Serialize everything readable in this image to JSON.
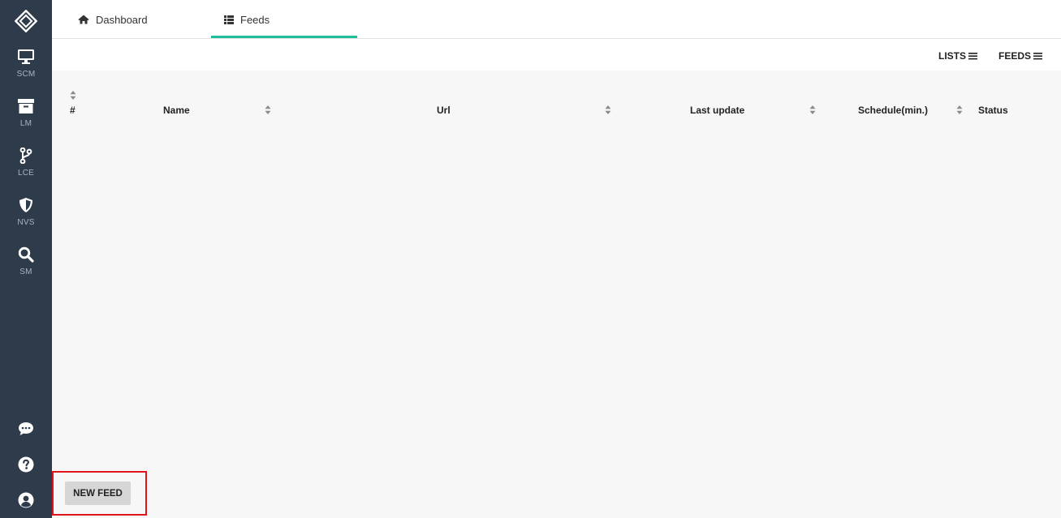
{
  "sidebar": {
    "items": [
      {
        "label": "SCM",
        "icon": "monitor-icon"
      },
      {
        "label": "LM",
        "icon": "archive-icon"
      },
      {
        "label": "LCE",
        "icon": "code-branch-icon"
      },
      {
        "label": "NVS",
        "icon": "shield-icon"
      },
      {
        "label": "SM",
        "icon": "search-icon"
      }
    ],
    "bottom_icons": [
      "chat-icon",
      "help-icon",
      "user-icon"
    ]
  },
  "tabs": [
    {
      "label": "Dashboard",
      "icon": "home-icon",
      "active": false
    },
    {
      "label": "Feeds",
      "icon": "list-icon",
      "active": true
    }
  ],
  "toolbar": {
    "lists_label": "LISTS",
    "feeds_label": "FEEDS"
  },
  "table": {
    "columns": [
      "#",
      "Name",
      "Url",
      "Last update",
      "Schedule(min.)",
      "Status"
    ],
    "rows": []
  },
  "actions": {
    "new_feed_label": "NEW FEED"
  },
  "colors": {
    "sidebar_bg": "#2e3b4b",
    "accent": "#1fbf9c",
    "highlight": "#e2141b"
  }
}
